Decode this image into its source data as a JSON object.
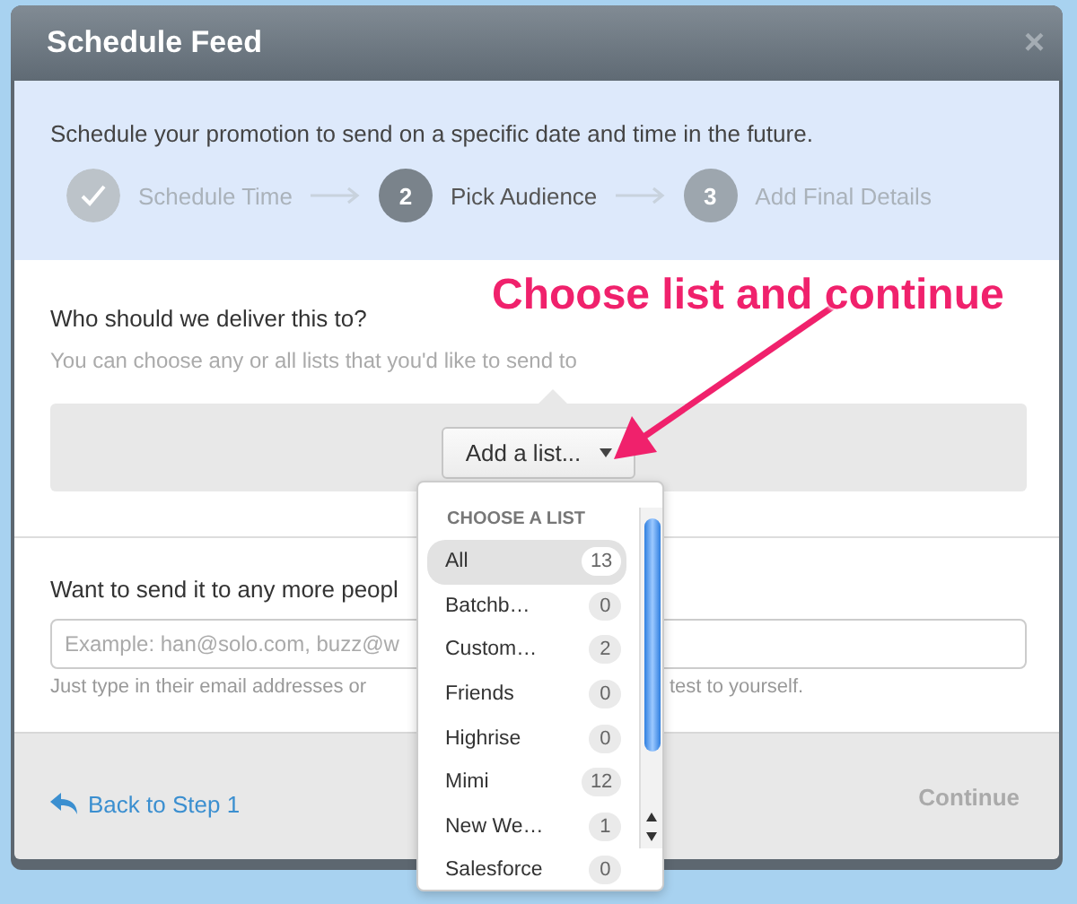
{
  "window": {
    "title": "Schedule Feed",
    "close": "×"
  },
  "intro": "Schedule your promotion to send on a specific date and time in the future.",
  "steps": [
    {
      "label": "Schedule Time",
      "completed": true,
      "selected": false
    },
    {
      "number": "2",
      "label": "Pick Audience",
      "completed": false,
      "selected": true
    },
    {
      "number": "3",
      "label": "Add Final Details",
      "completed": false,
      "selected": false
    }
  ],
  "audience": {
    "question": "Who should we deliver this to?",
    "hint": "You can choose any or all lists that you'd like to send to",
    "button": "Add a list..."
  },
  "more_people": {
    "label": "Want to send it to any more peopl",
    "placeholder": "Example: han@solo.com, buzz@w",
    "helper_left": "Just type in their email addresses or",
    "helper_right": "test to yourself."
  },
  "footer": {
    "back": "Back to Step 1",
    "continue": {
      "label": "Continue",
      "disabled": true
    }
  },
  "dropdown": {
    "title": "CHOOSE A LIST",
    "items": [
      {
        "name": "All",
        "count": "13",
        "selected": true
      },
      {
        "name": "Batchb…",
        "count": "0",
        "selected": false
      },
      {
        "name": "Custom…",
        "count": "2",
        "selected": false
      },
      {
        "name": "Friends",
        "count": "0",
        "selected": false
      },
      {
        "name": "Highrise",
        "count": "0",
        "selected": false
      },
      {
        "name": "Mimi",
        "count": "12",
        "selected": false
      },
      {
        "name": "New We…",
        "count": "1",
        "selected": false
      },
      {
        "name": "Salesforce",
        "count": "0",
        "selected": false
      }
    ]
  },
  "annotation": "Choose list and continue"
}
